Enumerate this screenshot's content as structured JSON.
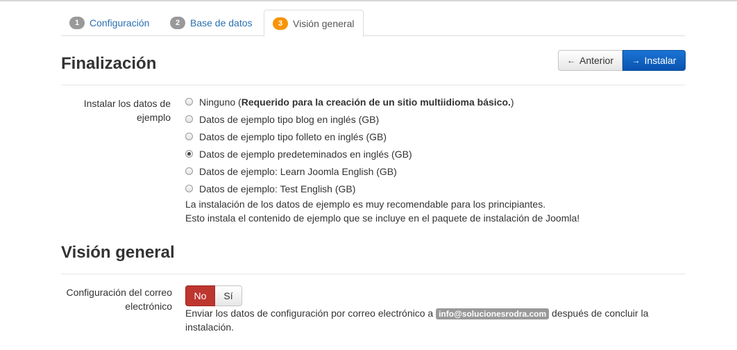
{
  "tabs": [
    {
      "num": "1",
      "label": "Configuración"
    },
    {
      "num": "2",
      "label": "Base de datos"
    },
    {
      "num": "3",
      "label": "Visión general"
    }
  ],
  "finalization": {
    "title": "Finalización",
    "prev_label": "Anterior",
    "install_label": "Instalar",
    "sample_label": "Instalar los datos de ejemplo",
    "options": [
      {
        "text": "Ninguno (",
        "bold": "Requerido para la creación de un sitio multiidioma básico.",
        "suffix": ")",
        "checked": false
      },
      {
        "text": "Datos de ejemplo tipo blog en inglés (GB)",
        "checked": false
      },
      {
        "text": "Datos de ejemplo tipo folleto en inglés (GB)",
        "checked": false
      },
      {
        "text": "Datos de ejemplo predeteminados en inglés (GB)",
        "checked": true
      },
      {
        "text": "Datos de ejemplo: Learn Joomla English (GB)",
        "checked": false
      },
      {
        "text": "Datos de ejemplo: Test English (GB)",
        "checked": false
      }
    ],
    "help_line1": "La instalación de los datos de ejemplo es muy recomendable para los principiantes.",
    "help_line2": "Esto instala el contenido de ejemplo que se incluye en el paquete de instalación de Joomla!"
  },
  "overview": {
    "title": "Visión general",
    "email_label": "Configuración del correo electrónico",
    "no_label": "No",
    "yes_label": "Sí",
    "selected": "No",
    "help_prefix": "Enviar los datos de configuración por correo electrónico a",
    "email": "info@solucionesrodra.com",
    "help_suffix": "después de concluir la instalación."
  }
}
